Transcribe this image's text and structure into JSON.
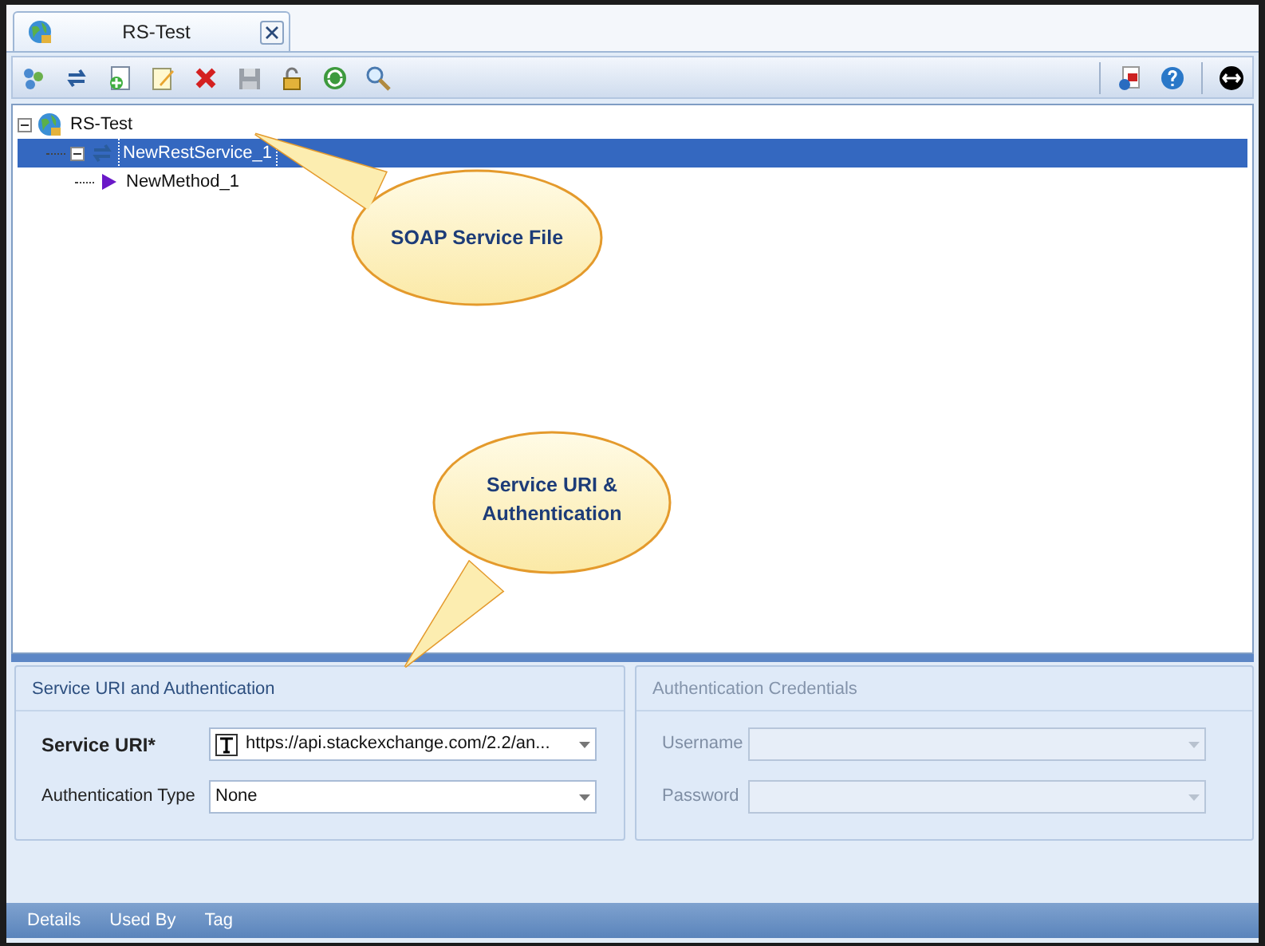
{
  "document_tab": {
    "title": "RS-Test",
    "selected": true
  },
  "tree": [
    {
      "label": "RS-Test",
      "kind": "project",
      "expanded": true,
      "selected": false,
      "children": [
        {
          "label": "NewRestService_1",
          "kind": "service",
          "expanded": true,
          "selected": true,
          "children": [
            {
              "label": "NewMethod_1",
              "kind": "method",
              "selected": false
            }
          ]
        }
      ]
    }
  ],
  "callouts": [
    {
      "text": "SOAP Service File"
    },
    {
      "text": "Service URI & Authentication"
    }
  ],
  "service_panel": {
    "title": "Service URI and Authentication",
    "disabled": false,
    "fields": [
      {
        "label": "Service URI*",
        "kind": "typed",
        "required": true,
        "value": "https://api.stackexchange.com/2.2/an..."
      },
      {
        "label": "Authentication Type",
        "kind": "plain",
        "required": false,
        "value": "None"
      }
    ]
  },
  "credentials_panel": {
    "title": "Authentication Credentials",
    "disabled": true,
    "fields": [
      {
        "label": "Username",
        "required": false
      },
      {
        "label": "Password",
        "required": false
      }
    ]
  },
  "bottom_tabs": [
    {
      "label": "Details"
    },
    {
      "label": "Used By"
    },
    {
      "label": "Tag"
    }
  ]
}
